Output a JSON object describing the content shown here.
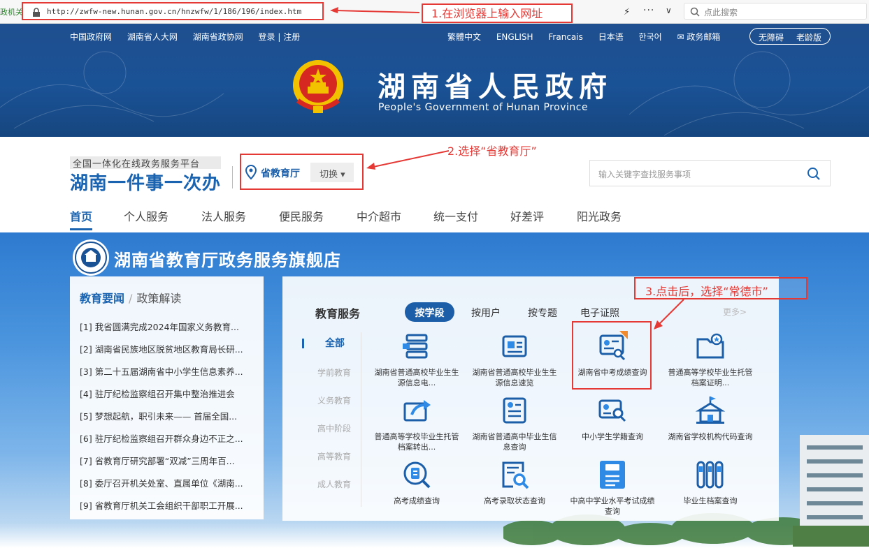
{
  "browser": {
    "left_tab_text": "政机关",
    "url": "http://zwfw-new.hunan.gov.cn/hnzwfw/1/186/196/index.htm",
    "search_placeholder": "点此搜索",
    "more_glyph": "···",
    "chevron_glyph": "∨",
    "bolt_glyph": "⚡"
  },
  "annotations": {
    "step1": "1.在浏览器上输入网址",
    "step2": "2.选择“省教育厅”",
    "step3": "3.点击后，选择“常德市”",
    "color": "#e53935"
  },
  "header": {
    "top_links_left": [
      "中国政府网",
      "湖南省人大网",
      "湖南省政协网",
      "登录 | 注册"
    ],
    "top_links_right": [
      "繁體中文",
      "ENGLISH",
      "Francais",
      "日本语",
      "한국어",
      "✉ 政务邮箱"
    ],
    "accessibility": [
      "无障碍",
      "老龄版"
    ],
    "title": "湖南省人民政府",
    "subtitle": "People's Government of Hunan Province",
    "bg_color": "#1a5296"
  },
  "platform": {
    "tagline": "全国一体化在线政务服务平台",
    "name": "湖南一件事一次办",
    "department": "省教育厅",
    "switch_label": "切换 ▾",
    "search_placeholder": "输入关键字查找服务事项"
  },
  "main_nav": [
    "首页",
    "个人服务",
    "法人服务",
    "便民服务",
    "中介超市",
    "统一支付",
    "好差评",
    "阳光政务"
  ],
  "flagship": {
    "title": "湖南省教育厅政务服务旗舰店",
    "news_tab_active": "教育要闻",
    "news_tab_sep": "/",
    "news_tab_other": "政策解读",
    "news": [
      {
        "num": "[1]",
        "text": "我省圆满完成2024年国家义务教育..."
      },
      {
        "num": "[2]",
        "text": "湖南省民族地区脱贫地区教育局长研..."
      },
      {
        "num": "[3]",
        "text": "第二十五届湖南省中小学生信息素养..."
      },
      {
        "num": "[4]",
        "text": "驻厅纪检监察组召开集中整治推进会"
      },
      {
        "num": "[5]",
        "text": "梦想起航，职引未来—— 首届全国..."
      },
      {
        "num": "[6]",
        "text": "驻厅纪检监察组召开群众身边不正之..."
      },
      {
        "num": "[7]",
        "text": "省教育厅研究部署“双减”三周年百..."
      },
      {
        "num": "[8]",
        "text": "委厅召开机关处室、直属单位《湖南..."
      },
      {
        "num": "[9]",
        "text": "省教育厅机关工会组织干部职工开展..."
      }
    ],
    "services_title": "教育服务",
    "tabs": [
      "按学段",
      "按用户",
      "按专题",
      "电子证照"
    ],
    "more": "更多>",
    "levels": [
      "全部",
      "学前教育",
      "义务教育",
      "高中阶段",
      "高等教育",
      "成人教育"
    ],
    "items": [
      {
        "label": "湖南省普通高校毕业生生源信息电...",
        "icon": "stack-icon"
      },
      {
        "label": "湖南省普通高校毕业生生源信息速览",
        "icon": "certificate-icon"
      },
      {
        "label": "湖南省中考成绩查询",
        "icon": "exam-score-icon"
      },
      {
        "label": "普通高等学校毕业生托管档案证明...",
        "icon": "archive-star-icon"
      },
      {
        "label": "普通高等学校毕业生托管档案转出...",
        "icon": "transfer-icon"
      },
      {
        "label": "湖南省普通高中毕业生信息查询",
        "icon": "document-list-icon"
      },
      {
        "label": "中小学生学籍查询",
        "icon": "id-search-icon"
      },
      {
        "label": "湖南省学校机构代码查询",
        "icon": "school-icon"
      },
      {
        "label": "高考成绩查询",
        "icon": "score-search-icon"
      },
      {
        "label": "高考录取状态查询",
        "icon": "admission-search-icon"
      },
      {
        "label": "中高中学业水平考试成绩查询",
        "icon": "score-100-icon"
      },
      {
        "label": "毕业生档案查询",
        "icon": "files-icon"
      }
    ],
    "accent": "#1c5fa8"
  }
}
